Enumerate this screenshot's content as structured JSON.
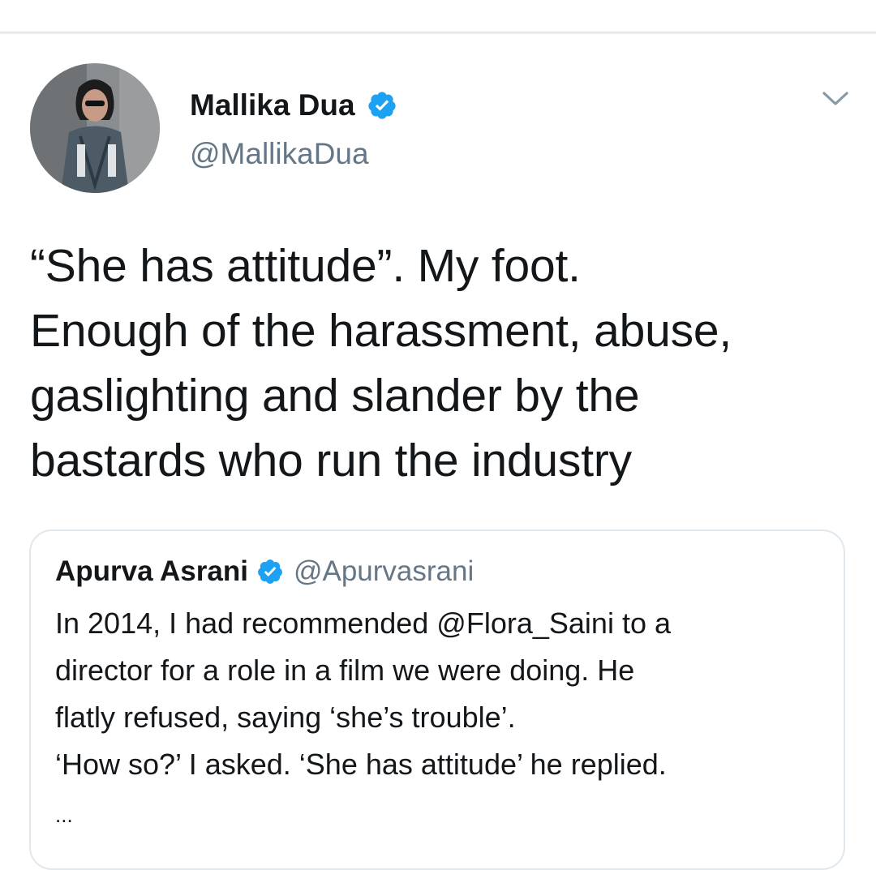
{
  "author": {
    "display_name": "Mallika Dua",
    "handle": "@MallikaDua",
    "verified_icon": "verified-badge-icon"
  },
  "tweet": {
    "text": "“She has attitude”. My foot.\nEnough of the harassment, abuse,\ngaslighting and slander by the\nbastards who run the industry"
  },
  "menu": {
    "icon": "chevron-down-icon"
  },
  "quoted_tweet": {
    "display_name": "Apurva Asrani",
    "handle": "@Apurvasrani",
    "text": "In 2014, I had recommended @Flora_Saini to a\ndirector for a role in a film we were doing. He\nflatly refused, saying ‘she’s trouble’.\n‘How so?’ I asked. ‘She has attitude’ he replied.",
    "truncation": "..."
  },
  "colors": {
    "text_primary": "#14171a",
    "text_secondary": "#657786",
    "verified_blue": "#1da1f2",
    "border": "#e1e8ed"
  }
}
